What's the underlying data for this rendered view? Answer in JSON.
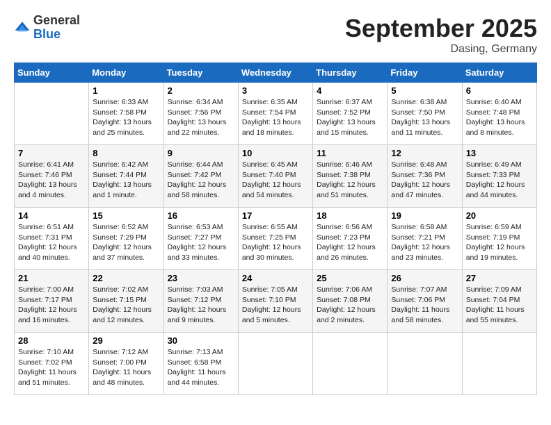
{
  "header": {
    "logo": {
      "general": "General",
      "blue": "Blue"
    },
    "title": "September 2025",
    "location": "Dasing, Germany"
  },
  "calendar": {
    "days_of_week": [
      "Sunday",
      "Monday",
      "Tuesday",
      "Wednesday",
      "Thursday",
      "Friday",
      "Saturday"
    ],
    "weeks": [
      [
        {
          "day": "",
          "info": ""
        },
        {
          "day": "1",
          "info": "Sunrise: 6:33 AM\nSunset: 7:58 PM\nDaylight: 13 hours\nand 25 minutes."
        },
        {
          "day": "2",
          "info": "Sunrise: 6:34 AM\nSunset: 7:56 PM\nDaylight: 13 hours\nand 22 minutes."
        },
        {
          "day": "3",
          "info": "Sunrise: 6:35 AM\nSunset: 7:54 PM\nDaylight: 13 hours\nand 18 minutes."
        },
        {
          "day": "4",
          "info": "Sunrise: 6:37 AM\nSunset: 7:52 PM\nDaylight: 13 hours\nand 15 minutes."
        },
        {
          "day": "5",
          "info": "Sunrise: 6:38 AM\nSunset: 7:50 PM\nDaylight: 13 hours\nand 11 minutes."
        },
        {
          "day": "6",
          "info": "Sunrise: 6:40 AM\nSunset: 7:48 PM\nDaylight: 13 hours\nand 8 minutes."
        }
      ],
      [
        {
          "day": "7",
          "info": "Sunrise: 6:41 AM\nSunset: 7:46 PM\nDaylight: 13 hours\nand 4 minutes."
        },
        {
          "day": "8",
          "info": "Sunrise: 6:42 AM\nSunset: 7:44 PM\nDaylight: 13 hours\nand 1 minute."
        },
        {
          "day": "9",
          "info": "Sunrise: 6:44 AM\nSunset: 7:42 PM\nDaylight: 12 hours\nand 58 minutes."
        },
        {
          "day": "10",
          "info": "Sunrise: 6:45 AM\nSunset: 7:40 PM\nDaylight: 12 hours\nand 54 minutes."
        },
        {
          "day": "11",
          "info": "Sunrise: 6:46 AM\nSunset: 7:38 PM\nDaylight: 12 hours\nand 51 minutes."
        },
        {
          "day": "12",
          "info": "Sunrise: 6:48 AM\nSunset: 7:36 PM\nDaylight: 12 hours\nand 47 minutes."
        },
        {
          "day": "13",
          "info": "Sunrise: 6:49 AM\nSunset: 7:33 PM\nDaylight: 12 hours\nand 44 minutes."
        }
      ],
      [
        {
          "day": "14",
          "info": "Sunrise: 6:51 AM\nSunset: 7:31 PM\nDaylight: 12 hours\nand 40 minutes."
        },
        {
          "day": "15",
          "info": "Sunrise: 6:52 AM\nSunset: 7:29 PM\nDaylight: 12 hours\nand 37 minutes."
        },
        {
          "day": "16",
          "info": "Sunrise: 6:53 AM\nSunset: 7:27 PM\nDaylight: 12 hours\nand 33 minutes."
        },
        {
          "day": "17",
          "info": "Sunrise: 6:55 AM\nSunset: 7:25 PM\nDaylight: 12 hours\nand 30 minutes."
        },
        {
          "day": "18",
          "info": "Sunrise: 6:56 AM\nSunset: 7:23 PM\nDaylight: 12 hours\nand 26 minutes."
        },
        {
          "day": "19",
          "info": "Sunrise: 6:58 AM\nSunset: 7:21 PM\nDaylight: 12 hours\nand 23 minutes."
        },
        {
          "day": "20",
          "info": "Sunrise: 6:59 AM\nSunset: 7:19 PM\nDaylight: 12 hours\nand 19 minutes."
        }
      ],
      [
        {
          "day": "21",
          "info": "Sunrise: 7:00 AM\nSunset: 7:17 PM\nDaylight: 12 hours\nand 16 minutes."
        },
        {
          "day": "22",
          "info": "Sunrise: 7:02 AM\nSunset: 7:15 PM\nDaylight: 12 hours\nand 12 minutes."
        },
        {
          "day": "23",
          "info": "Sunrise: 7:03 AM\nSunset: 7:12 PM\nDaylight: 12 hours\nand 9 minutes."
        },
        {
          "day": "24",
          "info": "Sunrise: 7:05 AM\nSunset: 7:10 PM\nDaylight: 12 hours\nand 5 minutes."
        },
        {
          "day": "25",
          "info": "Sunrise: 7:06 AM\nSunset: 7:08 PM\nDaylight: 12 hours\nand 2 minutes."
        },
        {
          "day": "26",
          "info": "Sunrise: 7:07 AM\nSunset: 7:06 PM\nDaylight: 11 hours\nand 58 minutes."
        },
        {
          "day": "27",
          "info": "Sunrise: 7:09 AM\nSunset: 7:04 PM\nDaylight: 11 hours\nand 55 minutes."
        }
      ],
      [
        {
          "day": "28",
          "info": "Sunrise: 7:10 AM\nSunset: 7:02 PM\nDaylight: 11 hours\nand 51 minutes."
        },
        {
          "day": "29",
          "info": "Sunrise: 7:12 AM\nSunset: 7:00 PM\nDaylight: 11 hours\nand 48 minutes."
        },
        {
          "day": "30",
          "info": "Sunrise: 7:13 AM\nSunset: 6:58 PM\nDaylight: 11 hours\nand 44 minutes."
        },
        {
          "day": "",
          "info": ""
        },
        {
          "day": "",
          "info": ""
        },
        {
          "day": "",
          "info": ""
        },
        {
          "day": "",
          "info": ""
        }
      ]
    ]
  }
}
